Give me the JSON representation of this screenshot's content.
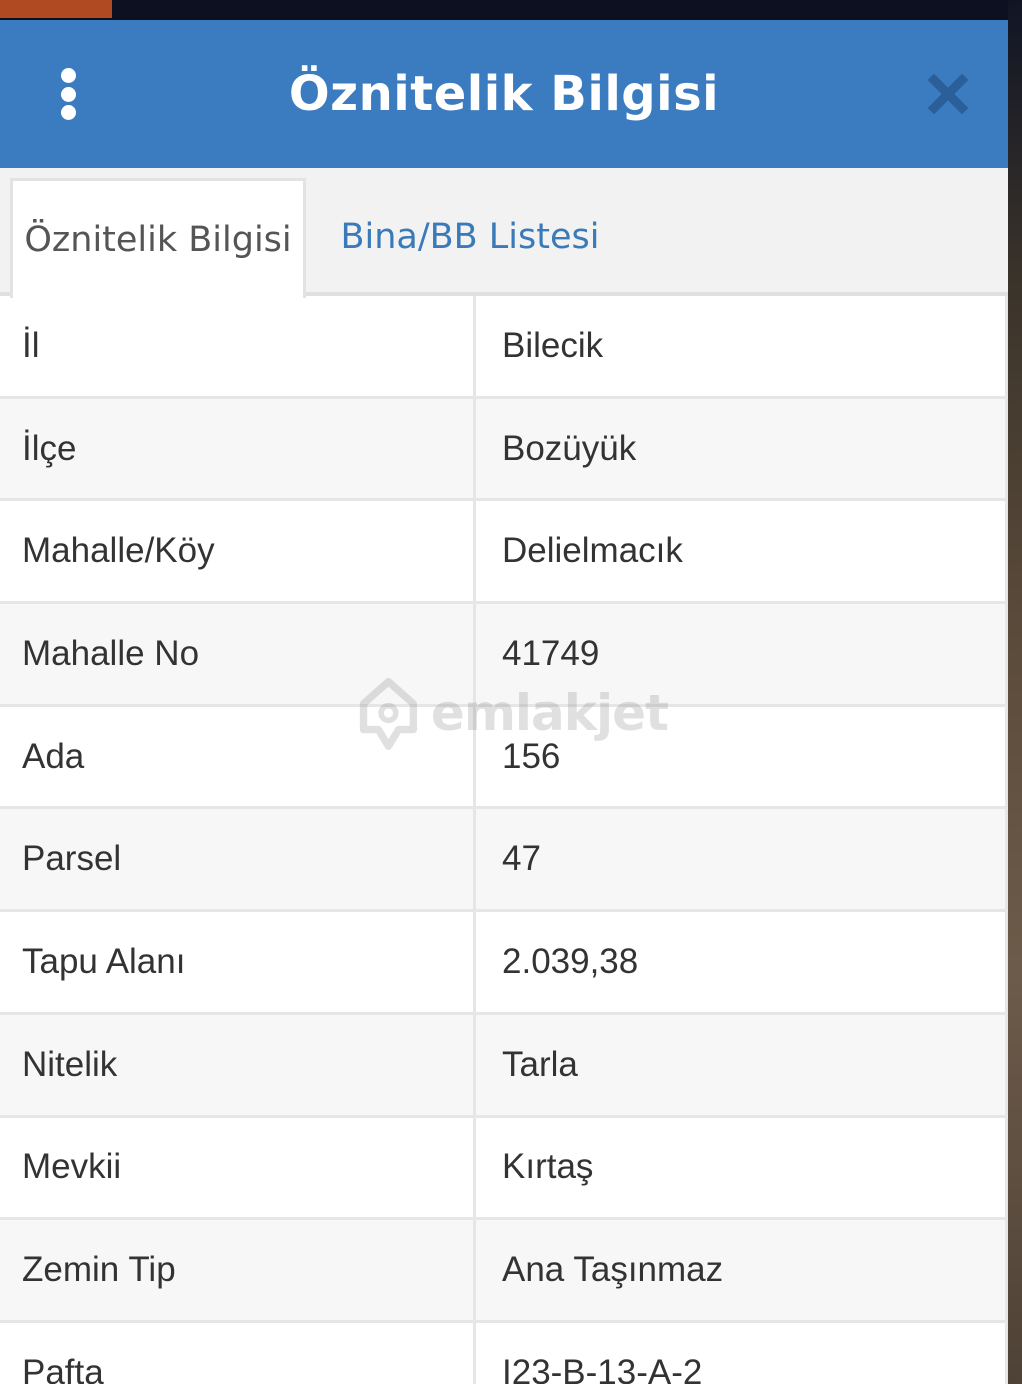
{
  "header": {
    "title": "Öznitelik Bilgisi",
    "menu_icon": "kebab-menu-icon",
    "close_icon": "close-icon",
    "color": "#3b7bbf"
  },
  "tabs": [
    {
      "label": "Öznitelik Bilgisi",
      "active": true
    },
    {
      "label": "Bina/BB Listesi",
      "active": false
    }
  ],
  "attributes": [
    {
      "label": "İl",
      "value": "Bilecik"
    },
    {
      "label": "İlçe",
      "value": "Bozüyük"
    },
    {
      "label": "Mahalle/Köy",
      "value": "Delielmacık"
    },
    {
      "label": "Mahalle No",
      "value": "41749"
    },
    {
      "label": "Ada",
      "value": "156"
    },
    {
      "label": "Parsel",
      "value": "47"
    },
    {
      "label": "Tapu Alanı",
      "value": "2.039,38"
    },
    {
      "label": "Nitelik",
      "value": "Tarla"
    },
    {
      "label": "Mevkii",
      "value": "Kırtaş"
    },
    {
      "label": "Zemin Tip",
      "value": "Ana Taşınmaz"
    },
    {
      "label": "Pafta",
      "value": "I23-B-13-A-2"
    }
  ],
  "watermark": {
    "text": "emlakjet",
    "icon": "location-pin-icon"
  }
}
